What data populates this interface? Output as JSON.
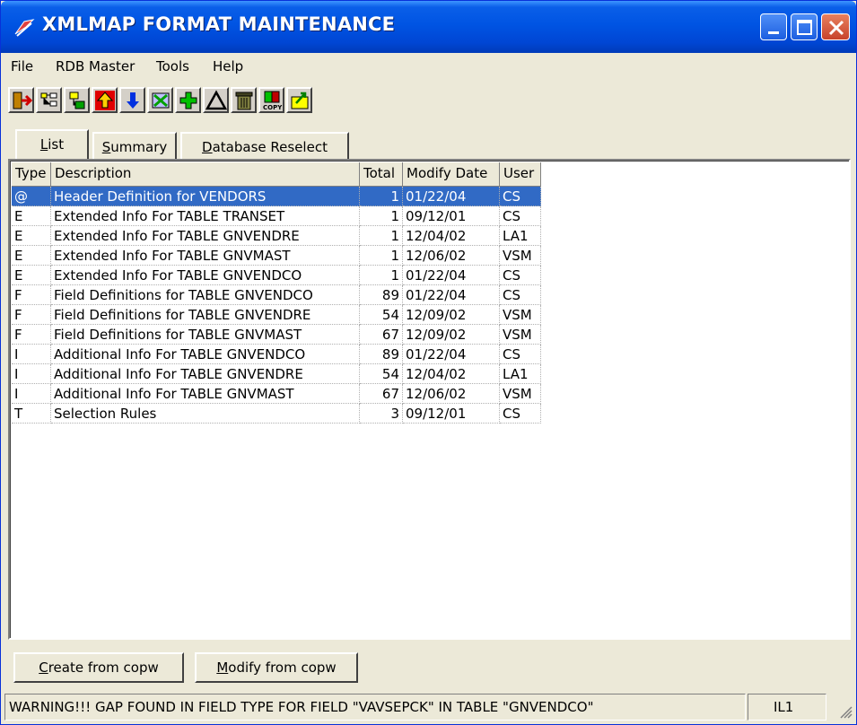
{
  "window": {
    "title": "XMLMAP FORMAT MAINTENANCE"
  },
  "menu": [
    "File",
    "RDB Master",
    "Tools",
    "Help"
  ],
  "toolbar": [
    {
      "icon": "exit-icon"
    },
    {
      "icon": "tree-icon"
    },
    {
      "icon": "hierarchy-icon"
    },
    {
      "icon": "arrow-up-icon"
    },
    {
      "icon": "arrow-down-icon"
    },
    {
      "icon": "edit-icon"
    },
    {
      "icon": "add-icon"
    },
    {
      "icon": "triangle-icon"
    },
    {
      "icon": "trash-icon"
    },
    {
      "icon": "copy-icon",
      "label": "COPY"
    },
    {
      "icon": "export-icon"
    }
  ],
  "tabs": [
    {
      "label": "List",
      "hotkey": "L",
      "rest": "ist"
    },
    {
      "label": "Summary",
      "hotkey": "S",
      "rest": "ummary"
    },
    {
      "label": "Database Reselect",
      "hotkey": "D",
      "rest": "atabase Reselect"
    }
  ],
  "table": {
    "columns": [
      "Type",
      "Description",
      "Total",
      "Modify Date",
      "User"
    ],
    "rows": [
      [
        "@",
        "Header Definition for VENDORS",
        "1",
        "01/22/04",
        "CS"
      ],
      [
        "E",
        "Extended Info For TABLE TRANSET",
        "1",
        "09/12/01",
        "CS"
      ],
      [
        "E",
        "Extended Info For TABLE GNVENDRE",
        "1",
        "12/04/02",
        "LA1"
      ],
      [
        "E",
        "Extended Info For TABLE GNVMAST",
        "1",
        "12/06/02",
        "VSM"
      ],
      [
        "E",
        "Extended Info For TABLE GNVENDCO",
        "1",
        "01/22/04",
        "CS"
      ],
      [
        "F",
        "Field Definitions for TABLE GNVENDCO",
        "89",
        "01/22/04",
        "CS"
      ],
      [
        "F",
        "Field Definitions for TABLE GNVENDRE",
        "54",
        "12/09/02",
        "VSM"
      ],
      [
        "F",
        "Field Definitions for TABLE GNVMAST",
        "67",
        "12/09/02",
        "VSM"
      ],
      [
        "I",
        "Additional Info For TABLE GNVENDCO",
        "89",
        "01/22/04",
        "CS"
      ],
      [
        "I",
        "Additional Info For TABLE GNVENDRE",
        "54",
        "12/04/02",
        "LA1"
      ],
      [
        "I",
        "Additional Info For TABLE GNVMAST",
        "67",
        "12/06/02",
        "VSM"
      ],
      [
        "T",
        "Selection Rules",
        "3",
        "09/12/01",
        "CS"
      ]
    ],
    "selected_row": 0
  },
  "buttons": {
    "create": {
      "hotkey": "C",
      "rest": "reate from copw"
    },
    "modify": {
      "hotkey": "M",
      "rest": "odify from copw"
    }
  },
  "status": {
    "message": "WARNING!!!  GAP FOUND IN FIELD TYPE FOR FIELD \"VAVSEPCK\" IN TABLE \"GNVENDCO\"",
    "user": "IL1"
  },
  "colors": {
    "title_bar": "#0054e3",
    "selection": "#316ac5",
    "face": "#ece9d8"
  }
}
